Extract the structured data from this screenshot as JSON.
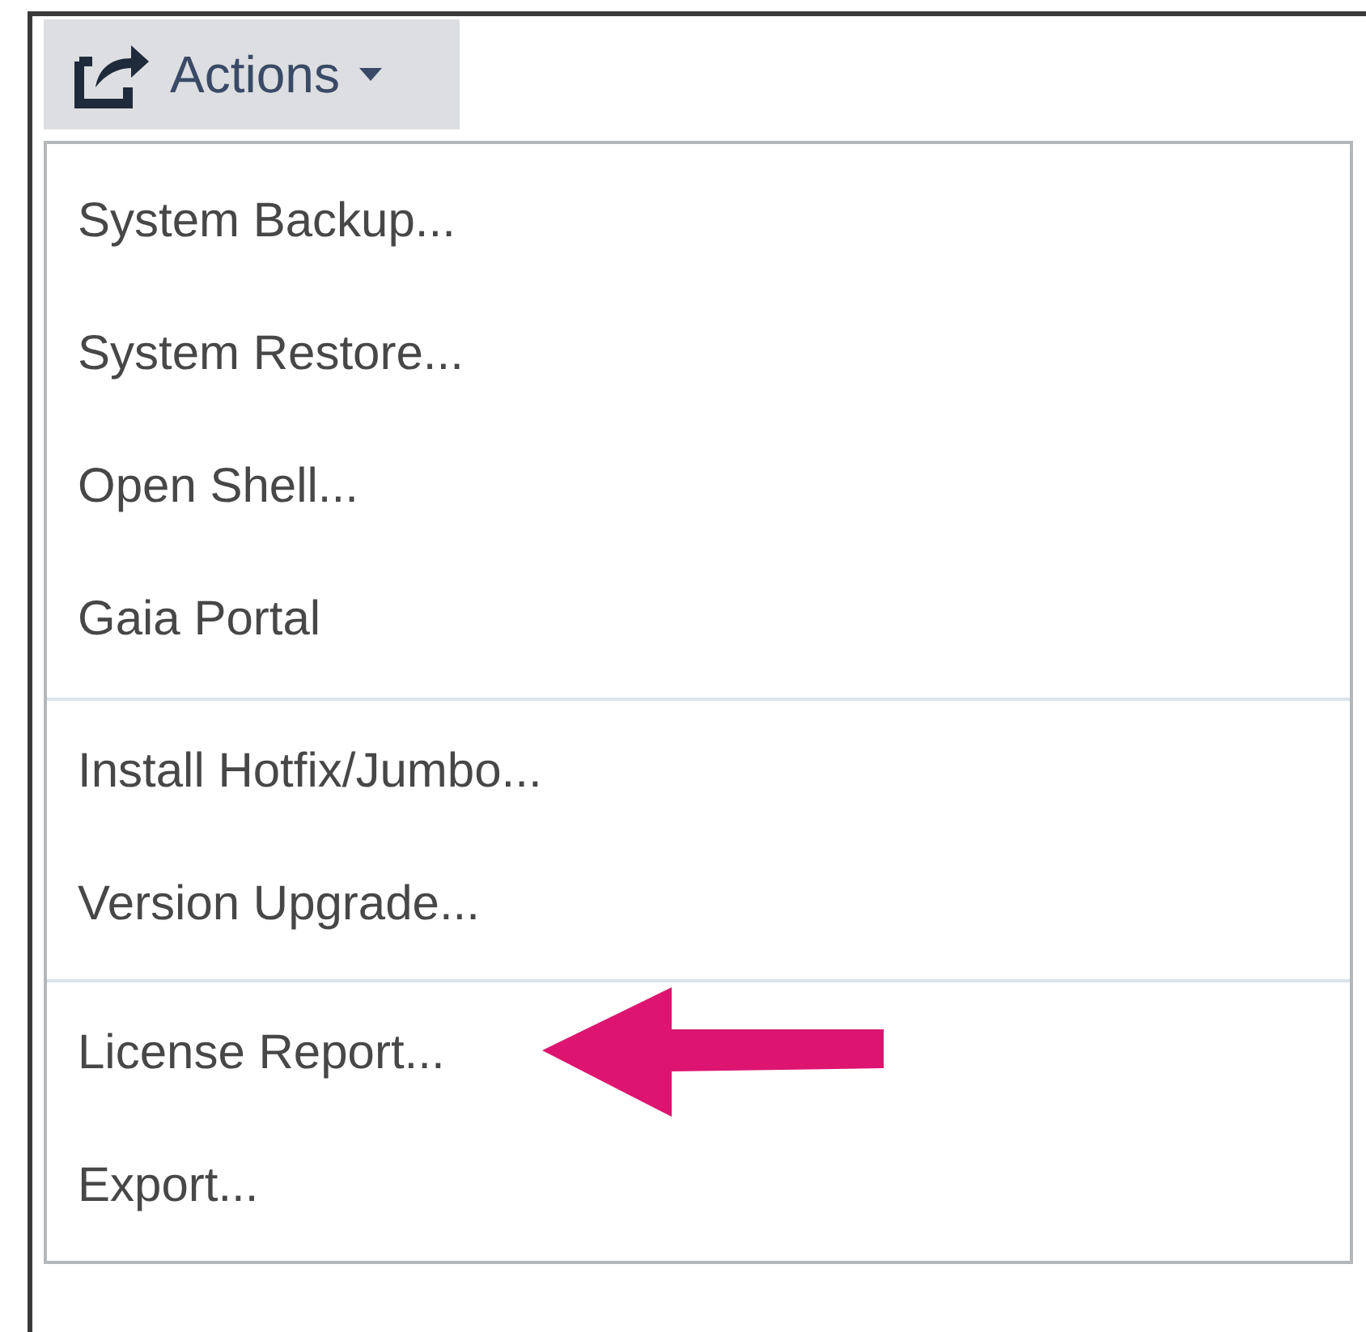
{
  "toolbar": {
    "button": {
      "label": "Actions",
      "expanded": true
    }
  },
  "menu": {
    "groups": [
      {
        "items": [
          {
            "label": "System Backup...",
            "pointed": false
          },
          {
            "label": "System Restore...",
            "pointed": false
          },
          {
            "label": "Open Shell...",
            "pointed": false
          },
          {
            "label": "Gaia Portal",
            "pointed": false
          }
        ]
      },
      {
        "items": [
          {
            "label": "Install Hotfix/Jumbo...",
            "pointed": false
          },
          {
            "label": "Version Upgrade...",
            "pointed": false
          }
        ]
      },
      {
        "items": [
          {
            "label": "License Report...",
            "pointed": true
          },
          {
            "label": "Export...",
            "pointed": false
          }
        ]
      }
    ]
  }
}
